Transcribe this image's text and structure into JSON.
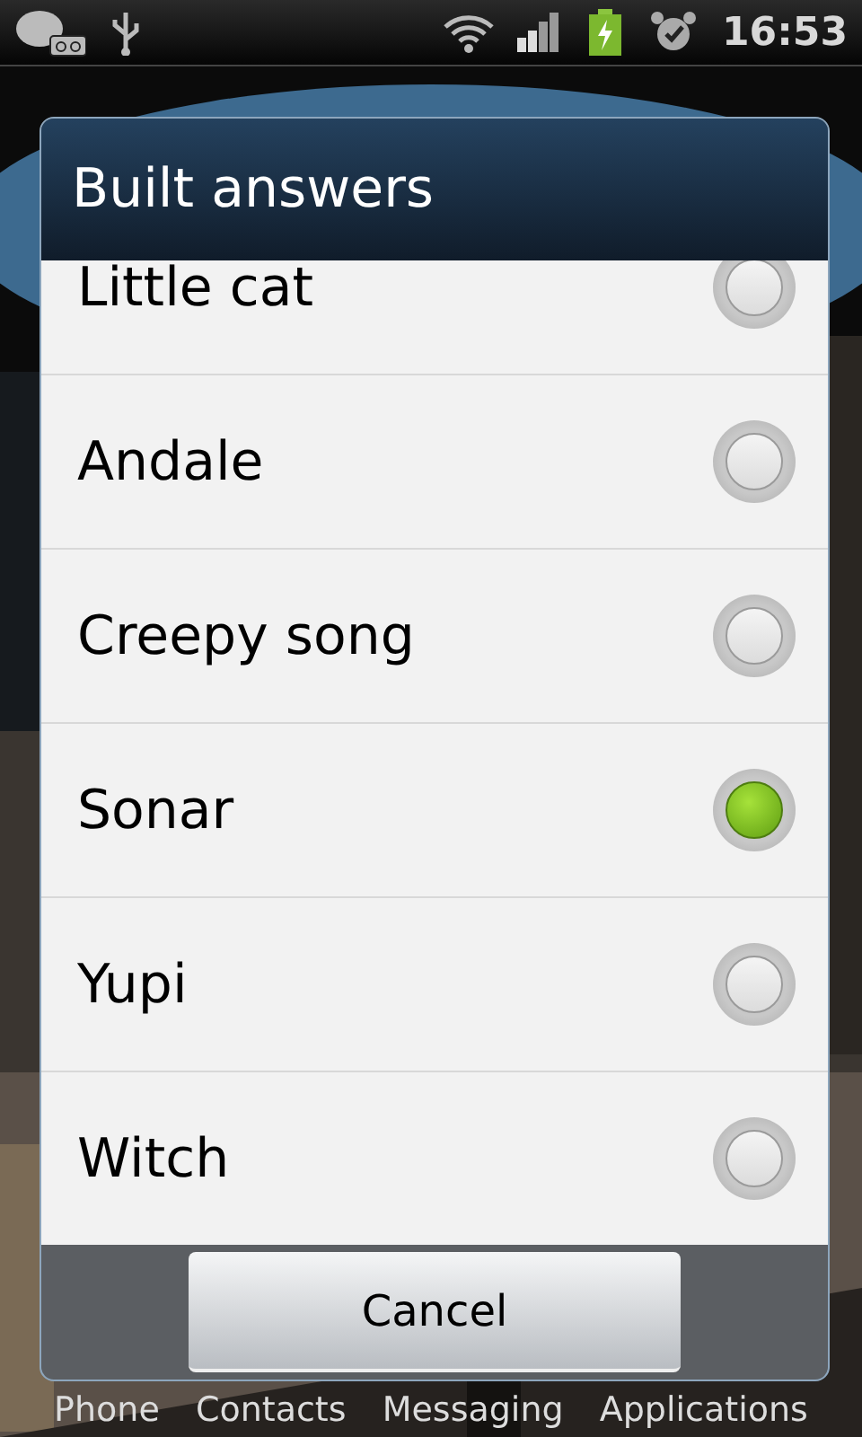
{
  "status_bar": {
    "time": "16:53"
  },
  "dialog": {
    "title": "Built answers",
    "options": [
      {
        "label": "Little cat",
        "selected": false
      },
      {
        "label": "Andale",
        "selected": false
      },
      {
        "label": "Creepy song",
        "selected": false
      },
      {
        "label": "Sonar",
        "selected": true
      },
      {
        "label": "Yupi",
        "selected": false
      },
      {
        "label": "Witch",
        "selected": false
      }
    ],
    "buttons": [
      "Cancel"
    ]
  },
  "dock": [
    "Phone",
    "Contacts",
    "Messaging",
    "Applications"
  ]
}
